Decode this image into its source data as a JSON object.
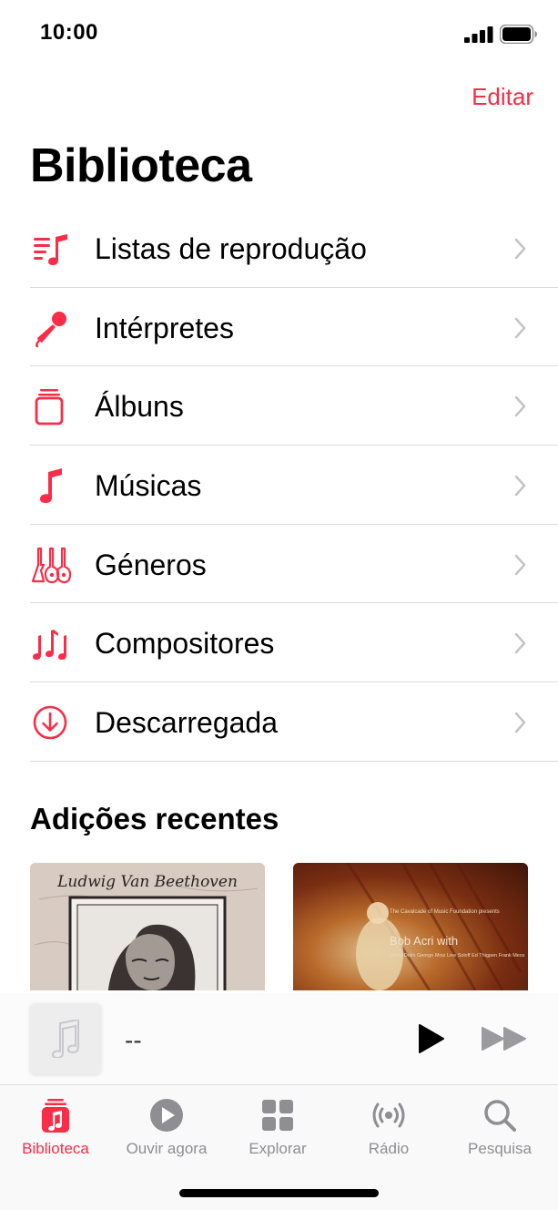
{
  "status_bar": {
    "time": "10:00"
  },
  "header": {
    "edit_label": "Editar",
    "title": "Biblioteca"
  },
  "menu": [
    {
      "label": "Listas de reprodução",
      "icon": "playlist-icon"
    },
    {
      "label": "Intérpretes",
      "icon": "microphone-icon"
    },
    {
      "label": "Álbuns",
      "icon": "album-stack-icon"
    },
    {
      "label": "Músicas",
      "icon": "music-note-icon"
    },
    {
      "label": "Géneros",
      "icon": "guitars-icon"
    },
    {
      "label": "Compositores",
      "icon": "music-notes-icon"
    },
    {
      "label": "Descarregada",
      "icon": "download-circle-icon"
    }
  ],
  "recent": {
    "title": "Adições recentes",
    "albums": [
      {
        "caption": "Ludwig Van Beethoven"
      },
      {
        "caption_small": "The Cavalcade of Music Foundation presents",
        "caption_main": "Bob Acri with",
        "caption_names": "Diane Delin George Moiz Lew Soloff Ed Thigpen Frank Mess"
      }
    ]
  },
  "mini_player": {
    "title": "--"
  },
  "tabs": [
    {
      "label": "Biblioteca",
      "icon": "library-icon",
      "active": true
    },
    {
      "label": "Ouvir agora",
      "icon": "play-circle-icon",
      "active": false
    },
    {
      "label": "Explorar",
      "icon": "grid-icon",
      "active": false
    },
    {
      "label": "Rádio",
      "icon": "radio-icon",
      "active": false
    },
    {
      "label": "Pesquisa",
      "icon": "search-icon",
      "active": false
    }
  ],
  "colors": {
    "accent": "#fa2d48",
    "inactive": "#8e8e93"
  }
}
